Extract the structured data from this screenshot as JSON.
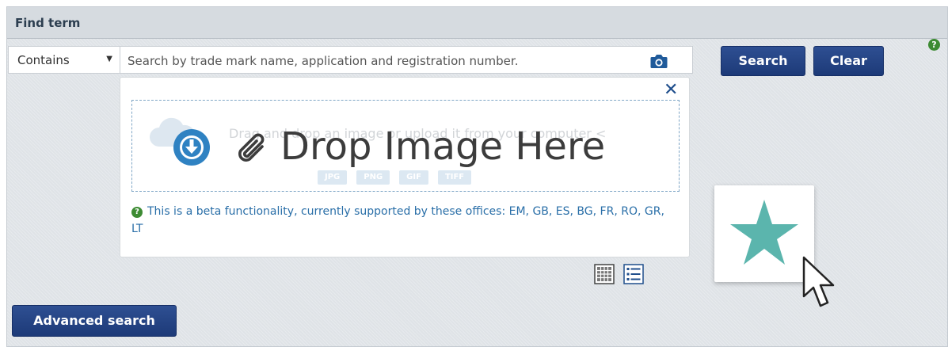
{
  "panel": {
    "title": "Find term"
  },
  "filter": {
    "selected": "Contains",
    "caret": "▼"
  },
  "search": {
    "placeholder": "Search by trade mark name, application and registration number.",
    "value": ""
  },
  "buttons": {
    "search": "Search",
    "clear": "Clear",
    "advanced": "Advanced search"
  },
  "help_icon": "?",
  "drop_panel": {
    "close": "✕",
    "faint_text": "Drag and drop an image or upload it from your computer <",
    "formats": [
      "JPG",
      "PNG",
      "GIF",
      "TIFF"
    ],
    "overlay_label": "Drop Image Here",
    "beta_note": "This is a beta functionality, currently supported by these offices: EM, GB, ES, BG, FR, RO, GR, LT"
  },
  "icons": {
    "camera": "camera-icon",
    "close": "close-icon",
    "cloud": "cloud-upload-icon",
    "download": "download-circle-icon",
    "paperclip": "paperclip-icon",
    "grid_view": "grid-view-icon",
    "list_view": "list-view-icon",
    "star": "star-icon",
    "cursor": "cursor-icon"
  },
  "colors": {
    "primary_button": "#1d3a78",
    "help_green": "#3d8b33",
    "link_blue": "#2a6fa8",
    "star_teal": "#5bb5ad",
    "download_blue": "#2f82c2"
  }
}
